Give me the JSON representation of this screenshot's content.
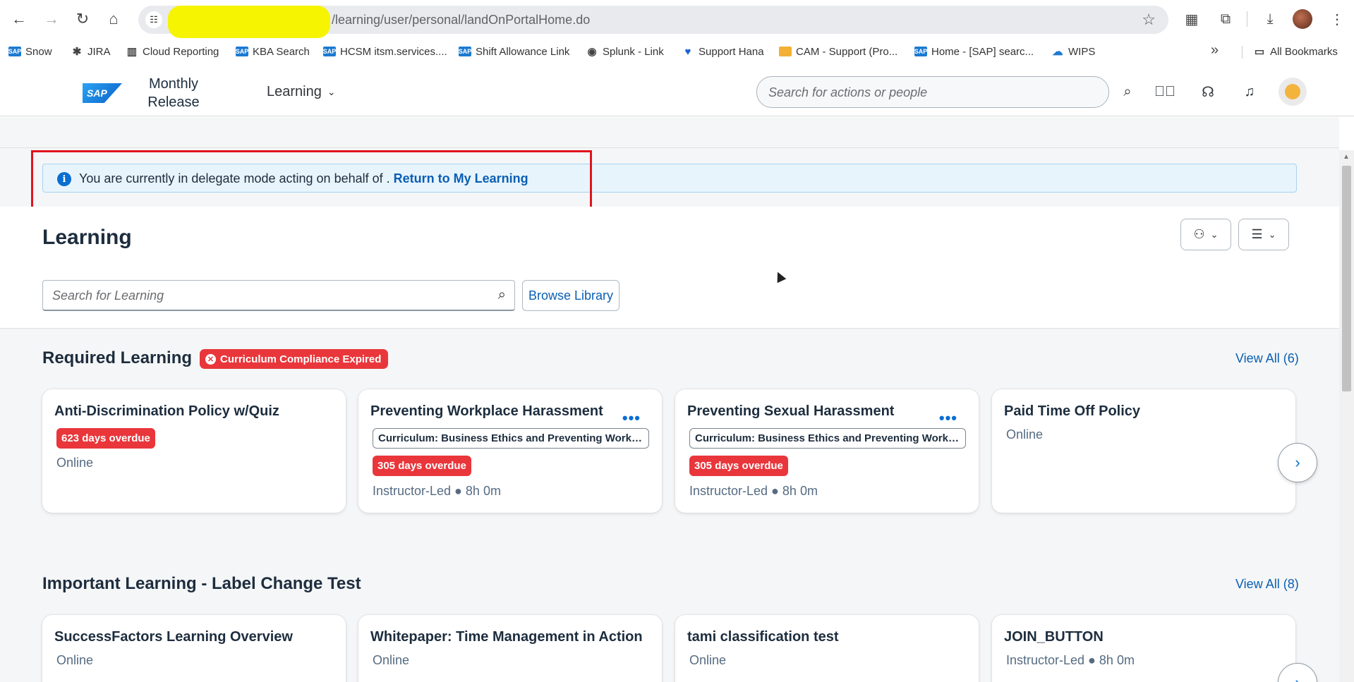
{
  "browser": {
    "url_visible": "/learning/user/personal/landOnPortalHome.do",
    "bookmarks": [
      {
        "label": "Snow",
        "icon": "sap-icon"
      },
      {
        "label": "JIRA",
        "icon": "jira-icon"
      },
      {
        "label": "Cloud Reporting",
        "icon": "chart-icon"
      },
      {
        "label": "KBA Search",
        "icon": "sap-icon"
      },
      {
        "label": "HCSM itsm.services....",
        "icon": "sap-icon"
      },
      {
        "label": "Shift Allowance Link",
        "icon": "sap-icon"
      },
      {
        "label": "Splunk - Link",
        "icon": "globe-icon"
      },
      {
        "label": "Support Hana",
        "icon": "heart-icon"
      },
      {
        "label": "CAM - Support (Pro...",
        "icon": "folder-icon"
      },
      {
        "label": "Home - [SAP] searc...",
        "icon": "sap-icon"
      },
      {
        "label": "WIPS",
        "icon": "wips-icon"
      }
    ],
    "all_bookmarks": "All Bookmarks"
  },
  "shell": {
    "logo": "SAP",
    "title": "Monthly Release",
    "menu_label": "Learning",
    "search_placeholder": "Search for actions or people"
  },
  "banner": {
    "text": "You are currently in delegate mode acting on behalf of .",
    "link": "Return to My Learning"
  },
  "page": {
    "title": "Learning",
    "search_placeholder": "Search for Learning",
    "browse_label": "Browse Library"
  },
  "required": {
    "title": "Required Learning",
    "badge": "Curriculum Compliance Expired",
    "view_all": "View All (6)",
    "cards": [
      {
        "title": "Anti-Discrimination Policy w/Quiz",
        "overdue": "623 days overdue",
        "meta": "Online"
      },
      {
        "title": "Preventing Workplace Harassment",
        "curriculum": "Curriculum: Business Ethics and Preventing Workplace Harassment",
        "overdue": "305 days overdue",
        "meta": "Instructor-Led ● 8h 0m",
        "more": "•••"
      },
      {
        "title": "Preventing Sexual Harassment",
        "curriculum": "Curriculum: Business Ethics and Preventing Workplace Harassment",
        "overdue": "305 days overdue",
        "meta": "Instructor-Led ● 8h 0m",
        "more": "•••"
      },
      {
        "title": "Paid Time Off Policy",
        "meta": "Online"
      }
    ]
  },
  "important": {
    "title": "Important Learning - Label Change Test",
    "view_all": "View All (8)",
    "cards": [
      {
        "title": "SuccessFactors Learning Overview",
        "meta": "Online"
      },
      {
        "title": "Whitepaper: Time Management in Action",
        "meta": "Online"
      },
      {
        "title": "tami classification test",
        "meta": "Online"
      },
      {
        "title": "JOIN_BUTTON",
        "meta": "Instructor-Led ● 8h 0m"
      }
    ]
  },
  "colors": {
    "accent": "#0a6ed1",
    "danger": "#e9363b",
    "highlight_box": "#e1141c",
    "redaction": "#f6f400"
  }
}
